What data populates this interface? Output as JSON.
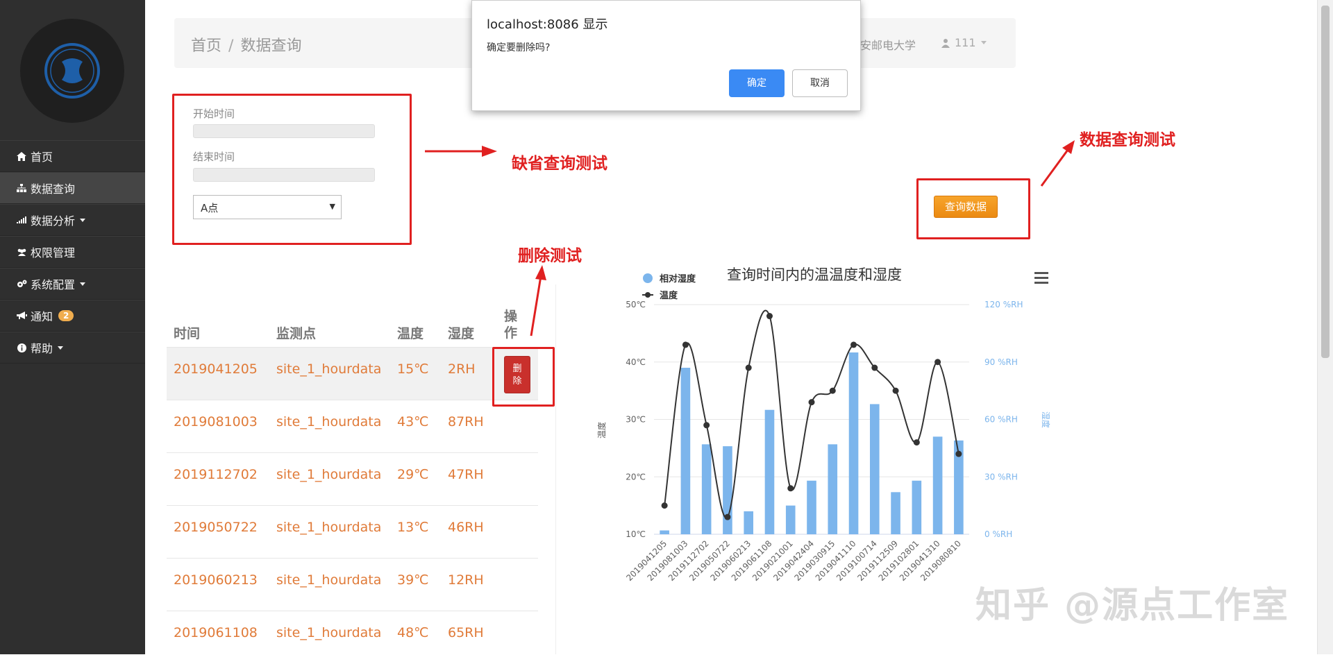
{
  "dialog": {
    "title": "localhost:8086 显示",
    "message": "确定要删除吗?",
    "ok_label": "确定",
    "cancel_label": "取消"
  },
  "sidebar": {
    "items": [
      {
        "label": "首页",
        "icon": "home-icon"
      },
      {
        "label": "数据查询",
        "icon": "sitemap-icon",
        "active": true
      },
      {
        "label": "数据分析",
        "icon": "signal-icon",
        "dropdown": true
      },
      {
        "label": "权限管理",
        "icon": "users-icon"
      },
      {
        "label": "系统配置",
        "icon": "gears-icon",
        "dropdown": true
      },
      {
        "label": "通知",
        "icon": "bullhorn-icon",
        "badge": "2"
      },
      {
        "label": "帮助",
        "icon": "info-icon",
        "dropdown": true
      }
    ]
  },
  "header": {
    "breadcrumb": [
      "首页",
      "数据查询"
    ],
    "org": "安邮电大学",
    "user": "111"
  },
  "filter": {
    "start_label": "开始时间",
    "end_label": "结束时间",
    "site_selected": "A点",
    "query_button": "查询数据"
  },
  "table": {
    "headers": [
      "时间",
      "监测点",
      "温度",
      "湿度",
      "操\n作"
    ],
    "delete_label": "删除",
    "rows": [
      [
        "2019041205",
        "site_1_hourdata",
        "15℃",
        "2RH"
      ],
      [
        "2019081003",
        "site_1_hourdata",
        "43℃",
        "87RH"
      ],
      [
        "2019112702",
        "site_1_hourdata",
        "29℃",
        "47RH"
      ],
      [
        "2019050722",
        "site_1_hourdata",
        "13℃",
        "46RH"
      ],
      [
        "2019060213",
        "site_1_hourdata",
        "39℃",
        "12RH"
      ],
      [
        "2019061108",
        "site_1_hourdata",
        "48℃",
        "65RH"
      ]
    ]
  },
  "annotations": {
    "default_query": "缺省查询测试",
    "data_query": "数据查询测试",
    "delete_test": "删除测试"
  },
  "watermark": "知乎 @源点工作室",
  "chart_data": {
    "type": "bar+line",
    "title": "查询时间内的温温度和湿度",
    "categories": [
      "2019041205",
      "2019081003",
      "2019112702",
      "2019050722",
      "2019060213",
      "2019061108",
      "2019021001",
      "2019042404",
      "2019030915",
      "2019041110",
      "2019100714",
      "2019112509",
      "2019102801",
      "2019041310",
      "2019080810"
    ],
    "series": [
      {
        "name": "相对湿度",
        "type": "bar",
        "axis": "right",
        "color": "#7cb5ec",
        "values": [
          2,
          87,
          47,
          46,
          12,
          65,
          15,
          28,
          47,
          95,
          68,
          22,
          28,
          51,
          49
        ]
      },
      {
        "name": "温度",
        "type": "line",
        "axis": "left",
        "color": "#333333",
        "values": [
          15,
          43,
          29,
          13,
          39,
          48,
          18,
          33,
          35,
          43,
          39,
          35,
          26,
          40,
          24
        ]
      }
    ],
    "left_axis": {
      "label": "温度",
      "ticks": [
        "10℃",
        "20℃",
        "30℃",
        "40℃",
        "50℃"
      ],
      "range": [
        10,
        50
      ]
    },
    "right_axis": {
      "label": "湿度",
      "ticks": [
        "0 %RH",
        "30 %RH",
        "60 %RH",
        "90 %RH",
        "120 %RH"
      ],
      "range": [
        0,
        120
      ]
    },
    "legend_position": "top-left",
    "grid": true
  }
}
